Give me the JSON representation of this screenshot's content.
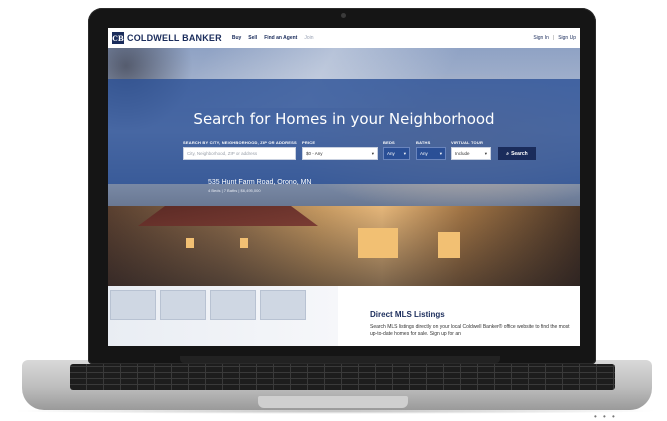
{
  "header": {
    "logo_text": "COLDWELL BANKER",
    "nav": [
      "Buy",
      "Sell",
      "Find an Agent",
      "Join"
    ],
    "sign_in": "Sign In",
    "separator": "|",
    "sign_up": "Sign Up"
  },
  "hero": {
    "title": "Search for Homes in your Neighborhood",
    "fields": {
      "location_label": "SEARCH BY CITY, NEIGHBORHOOD, ZIP OR ADDRESS",
      "location_placeholder": "City, Neighborhood, ZIP or address",
      "price_label": "PRICE",
      "price_value": "$0 - Any",
      "beds_label": "BEDS",
      "beds_value": "Any",
      "baths_label": "BATHS",
      "baths_value": "Any",
      "tour_label": "VIRTUAL TOUR",
      "tour_value": "Include"
    },
    "search_button": "Search",
    "featured_address": "535 Hunt Farm Road, Orono, MN",
    "featured_details": "4 Beds | 7 Baths | $6,495,000"
  },
  "mls": {
    "title": "Direct MLS Listings",
    "body": "Search MLS listings directly on your local Coldwell Banker® office website to find the most up-to-date homes for sale. Sign up for an"
  },
  "colors": {
    "brand_navy": "#1a2c5b",
    "search_band": "#2a5096"
  }
}
